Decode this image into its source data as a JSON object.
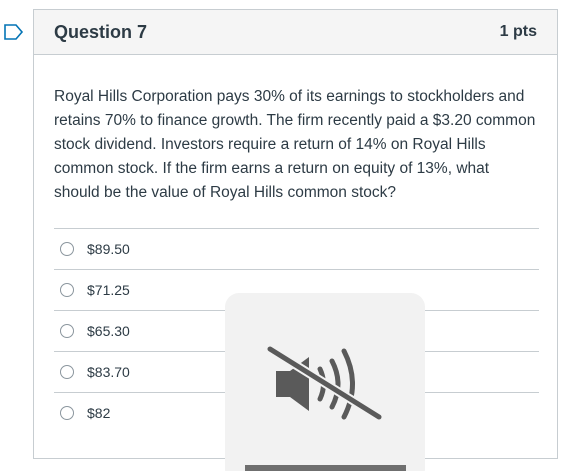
{
  "question": {
    "title": "Question 7",
    "points": "1 pts",
    "text": "Royal Hills Corporation pays 30% of its earnings to stockholders and retains 70% to finance growth.  The firm recently paid a $3.20 common stock dividend.  Investors require a return of 14% on Royal Hills common stock.  If the firm earns a return on equity of 13%, what should be the value of Royal Hills common stock?"
  },
  "answers": [
    {
      "label": "$89.50"
    },
    {
      "label": "$71.25"
    },
    {
      "label": "$65.30"
    },
    {
      "label": "$83.70"
    },
    {
      "label": "$82"
    }
  ],
  "icons": {
    "flag": "bookmark-flag-icon",
    "overlay": "muted-speaker-icon"
  },
  "colors": {
    "flag_accent": "#0374b5",
    "header_bg": "#f5f5f5",
    "border": "#c7cdd1",
    "text": "#2d3b45",
    "overlay_bg": "#f2f2f2",
    "mute_icon": "#5a5a5a"
  }
}
